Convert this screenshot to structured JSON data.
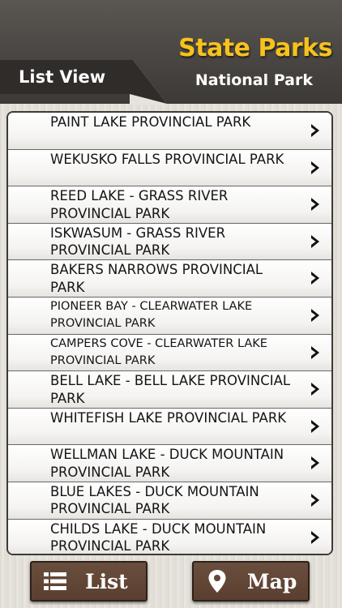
{
  "header": {
    "title": "State Parks",
    "subtitle": "National Park",
    "tab_label": "List View"
  },
  "parks": [
    {
      "name": "PAINT LAKE PROVINCIAL PARK"
    },
    {
      "name": "WEKUSKO FALLS PROVINCIAL PARK"
    },
    {
      "name": "REED LAKE - GRASS RIVER PROVINCIAL PARK"
    },
    {
      "name": "ISKWASUM - GRASS RIVER PROVINCIAL PARK"
    },
    {
      "name": "BAKERS NARROWS PROVINCIAL PARK"
    },
    {
      "name": "PIONEER BAY - CLEARWATER LAKE PROVINCIAL PARK"
    },
    {
      "name": "CAMPERS COVE - CLEARWATER LAKE PROVINCIAL PARK"
    },
    {
      "name": "BELL LAKE - BELL LAKE PROVINCIAL PARK"
    },
    {
      "name": "WHITEFISH LAKE PROVINCIAL PARK"
    },
    {
      "name": "WELLMAN LAKE - DUCK MOUNTAIN PROVINCIAL PARK"
    },
    {
      "name": "BLUE LAKES - DUCK MOUNTAIN PROVINCIAL PARK"
    },
    {
      "name": "CHILDS LAKE - DUCK MOUNTAIN PROVINCIAL PARK"
    }
  ],
  "footer": {
    "list_label": "List",
    "map_label": "Map"
  },
  "icons": {
    "row_arrow": "chevron-right-icon",
    "list": "list-icon",
    "map": "map-pin-icon"
  },
  "colors": {
    "accent": "#f6c21c",
    "header_bg": "#4a4744",
    "button_bg": "#634836"
  }
}
